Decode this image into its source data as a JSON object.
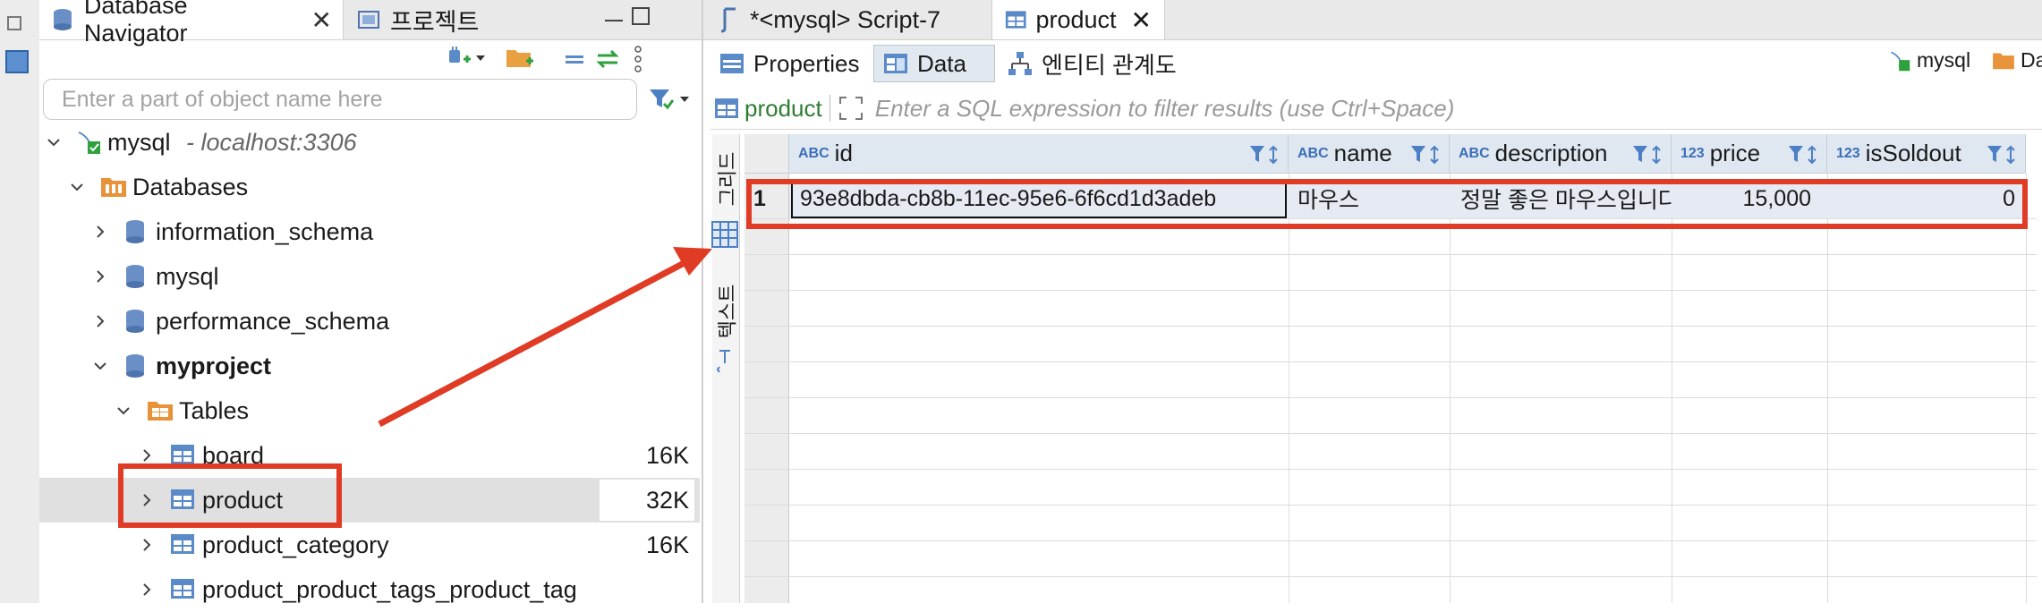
{
  "navigator": {
    "tab_title": "Database Navigator",
    "tab2_title": "프로젝트",
    "search_placeholder": "Enter a part of object name here",
    "connection": {
      "name": "mysql",
      "host": "- localhost:3306"
    },
    "tree": {
      "databases_label": "Databases",
      "dbs": [
        "information_schema",
        "mysql",
        "performance_schema",
        "myproject"
      ],
      "tables_label": "Tables",
      "tables": [
        {
          "name": "board",
          "size": "16K"
        },
        {
          "name": "product",
          "size": "32K"
        },
        {
          "name": "product_category",
          "size": "16K"
        },
        {
          "name": "product_product_tags_product_tag",
          "size": ""
        }
      ]
    }
  },
  "editor": {
    "tabs": [
      "*<mysql> Script-7",
      "product"
    ],
    "subtabs": [
      "Properties",
      "Data",
      "엔티티 관계도"
    ],
    "right_connection": "mysql",
    "right_db_abbrev": "Datas",
    "filter": {
      "table": "product",
      "placeholder": "Enter a SQL expression to filter results (use Ctrl+Space)"
    },
    "side_tabs": {
      "grid": "그리드",
      "text": "텍스트"
    },
    "columns": [
      {
        "type": "ABC",
        "name": "id"
      },
      {
        "type": "ABC",
        "name": "name"
      },
      {
        "type": "ABC",
        "name": "description"
      },
      {
        "type": "123",
        "name": "price"
      },
      {
        "type": "123",
        "name": "isSoldout"
      }
    ],
    "rows": [
      {
        "num": "1",
        "id": "93e8dbda-cb8b-11ec-95e6-6f6cd1d3adeb",
        "name": "마우스",
        "description": "정말 좋은 마우스입니다",
        "price": "15,000",
        "isSoldout": "0"
      }
    ]
  },
  "colors": {
    "annotation_red": "#e03b25",
    "header_blue": "#dfe7f1",
    "accent": "#3a6fb8"
  }
}
